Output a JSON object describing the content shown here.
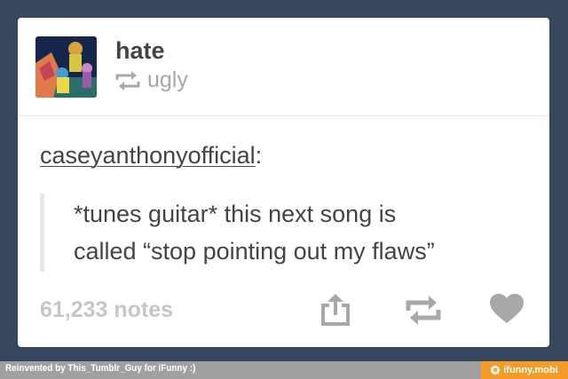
{
  "post": {
    "blog_name": "hate",
    "reblogged_from": "ugly",
    "poster_username": "caseyanthonyofficial",
    "poster_colon": ":",
    "quote_line_1": "*tunes guitar* this next song is",
    "quote_line_2": "called “stop pointing out my flaws”",
    "notes": "61,233 notes"
  },
  "icons": {
    "avatar": "cartoon-avatar",
    "reblog_indicator": "reblog-icon",
    "share": "share-icon",
    "reblog": "reblog-icon",
    "like": "heart-icon"
  },
  "footer": {
    "credit": "Reinvented by This_Tumblr_Guy for iFunny :)",
    "brand": "ifunny.mobi"
  },
  "colors": {
    "background": "#36465d",
    "card": "#ffffff",
    "text": "#444444",
    "muted": "#a7a7a7",
    "icons": "#a8a8a8",
    "brand": "#f39c27"
  }
}
